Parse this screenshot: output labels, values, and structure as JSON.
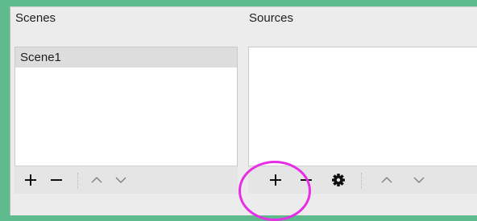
{
  "colors": {
    "background_accent": "#5dbb8e",
    "window_bg": "#ececec",
    "selected_row": "#dddddd",
    "highlight_ring": "#e62ee6"
  },
  "scenes": {
    "title": "Scenes",
    "items": [
      {
        "label": "Scene1",
        "selected": true
      }
    ],
    "toolbar": {
      "add_icon": "plus-icon",
      "remove_icon": "minus-icon",
      "move_up_icon": "chevron-up-icon",
      "move_down_icon": "chevron-down-icon"
    }
  },
  "sources": {
    "title": "Sources",
    "items": [],
    "toolbar": {
      "add_icon": "plus-icon",
      "remove_icon": "minus-icon",
      "properties_icon": "gear-icon",
      "move_up_icon": "chevron-up-icon",
      "move_down_icon": "chevron-down-icon"
    }
  },
  "annotation": {
    "type": "circle-highlight",
    "target": "sources-add-button"
  }
}
